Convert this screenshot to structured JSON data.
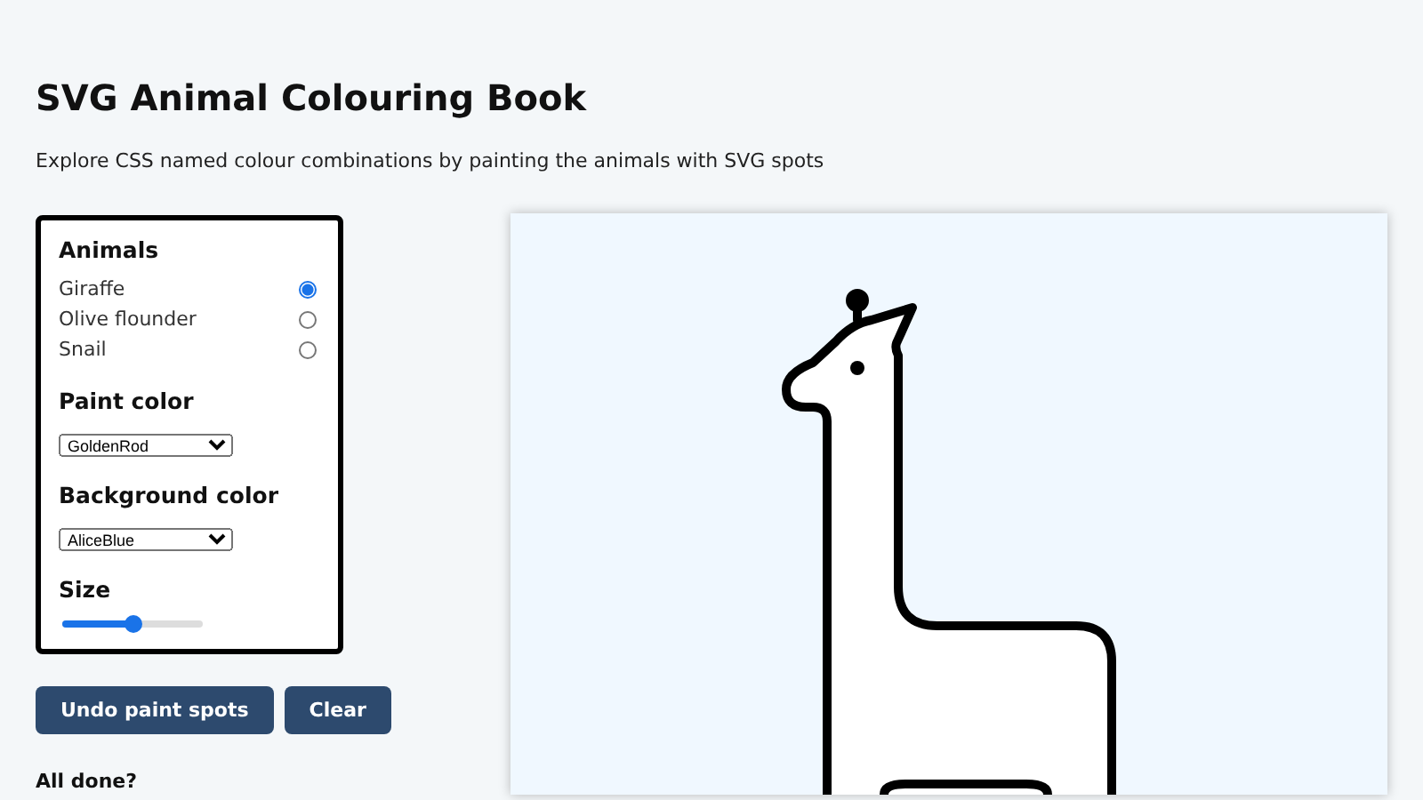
{
  "title": "SVG Animal Colouring Book",
  "subtitle": "Explore CSS named colour combinations by painting the animals with SVG spots",
  "controls": {
    "animals": {
      "heading": "Animals",
      "options": [
        {
          "label": "Giraffe",
          "selected": true
        },
        {
          "label": "Olive flounder",
          "selected": false
        },
        {
          "label": "Snail",
          "selected": false
        }
      ]
    },
    "paint_color": {
      "heading": "Paint color",
      "value": "GoldenRod"
    },
    "background_color": {
      "heading": "Background color",
      "value": "AliceBlue"
    },
    "size": {
      "heading": "Size",
      "level": 0.51
    }
  },
  "buttons": [
    "Undo paint spots",
    "Clear"
  ],
  "footer_heading": "All done?"
}
